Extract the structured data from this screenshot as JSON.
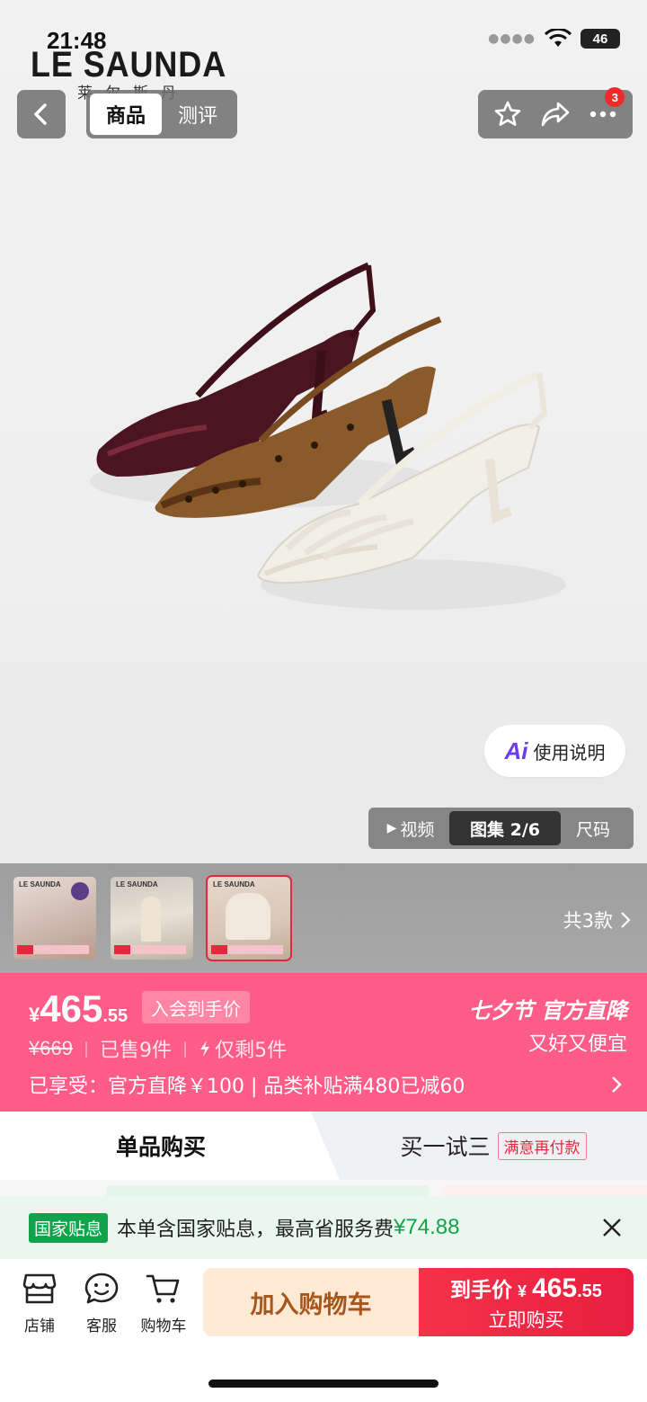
{
  "status": {
    "time": "21:48",
    "network": "46"
  },
  "brand": {
    "name_en": "LE SAUNDA",
    "name_cn": "莱尔斯丹"
  },
  "top_nav": {
    "tabs": [
      "商品",
      "测评"
    ],
    "active_tab": 0,
    "notification_count": "3",
    "icons": [
      "back-icon",
      "star-icon",
      "share-icon",
      "more-icon"
    ]
  },
  "hero": {
    "ai_button_label": "使用说明",
    "ai_mark": "Ai",
    "media_tabs": {
      "video": "视频",
      "gallery": "图集 2/6",
      "size": "尺码"
    }
  },
  "variants": {
    "count_label": "共3款",
    "thumb_logo": "LE SAUNDA",
    "selected_index": 2
  },
  "price_banner": {
    "currency": "¥",
    "price_int": "465",
    "price_dec": ".55",
    "member_tag": "入会到手价",
    "original_price": "¥669",
    "sold": "已售9件",
    "stock": "仅剩5件",
    "festival_title": "七夕节 官方直降",
    "festival_sub": "又好又便宜",
    "benefits": "已享受：官方直降￥100 | 品类补贴满480已减60"
  },
  "purchase_modes": {
    "single": "单品购买",
    "try_three": "买一试三",
    "try_badge": "满意再付款"
  },
  "subsidy": {
    "tag": "国家贴息",
    "text": "本单含国家贴息，最高省服务费",
    "amount": "¥74.88"
  },
  "bottom_bar": {
    "shop": "店铺",
    "service": "客服",
    "cart": "购物车",
    "add_to_cart": "加入购物车",
    "buy_label": "到手价",
    "buy_currency": "¥",
    "buy_price_int": "465",
    "buy_price_dec": ".55",
    "buy_now": "立即购买"
  },
  "colors": {
    "brand_red": "#e81e3e",
    "banner_pink": "#ff5c87",
    "subsidy_green": "#11a34a",
    "cart_button": "#fde9d4"
  }
}
